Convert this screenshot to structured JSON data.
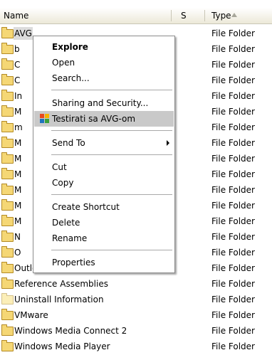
{
  "header": {
    "name": "Name",
    "size": "S",
    "type": "Type"
  },
  "rows": [
    {
      "name": "AVG",
      "type": "File Folder"
    },
    {
      "name": "b",
      "type": "File Folder"
    },
    {
      "name": "C",
      "type": "File Folder"
    },
    {
      "name": "C",
      "type": "File Folder"
    },
    {
      "name": "In",
      "type": "File Folder"
    },
    {
      "name": "M",
      "type": "File Folder"
    },
    {
      "name": "m",
      "type": "File Folder"
    },
    {
      "name": "M",
      "type": "File Folder"
    },
    {
      "name": "M",
      "type": "File Folder"
    },
    {
      "name": "M",
      "type": "File Folder"
    },
    {
      "name": "M",
      "type": "File Folder"
    },
    {
      "name": "M",
      "type": "File Folder"
    },
    {
      "name": "M",
      "type": "File Folder"
    },
    {
      "name": "N",
      "type": "File Folder"
    },
    {
      "name": "O",
      "type": "File Folder"
    },
    {
      "name": "Outlook Express",
      "type": "File Folder"
    },
    {
      "name": "Reference Assemblies",
      "type": "File Folder"
    },
    {
      "name": "Uninstall Information",
      "type": "File Folder"
    },
    {
      "name": "VMware",
      "type": "File Folder"
    },
    {
      "name": "Windows Media Connect 2",
      "type": "File Folder"
    },
    {
      "name": "Windows Media Player",
      "type": "File Folder"
    }
  ],
  "menu": {
    "explore": "Explore",
    "open": "Open",
    "search": "Search...",
    "sharing": "Sharing and Security...",
    "avg_scan": "Testirati sa AVG-om",
    "send_to": "Send To",
    "cut": "Cut",
    "copy": "Copy",
    "create_shortcut": "Create Shortcut",
    "delete": "Delete",
    "rename": "Rename",
    "properties": "Properties"
  }
}
